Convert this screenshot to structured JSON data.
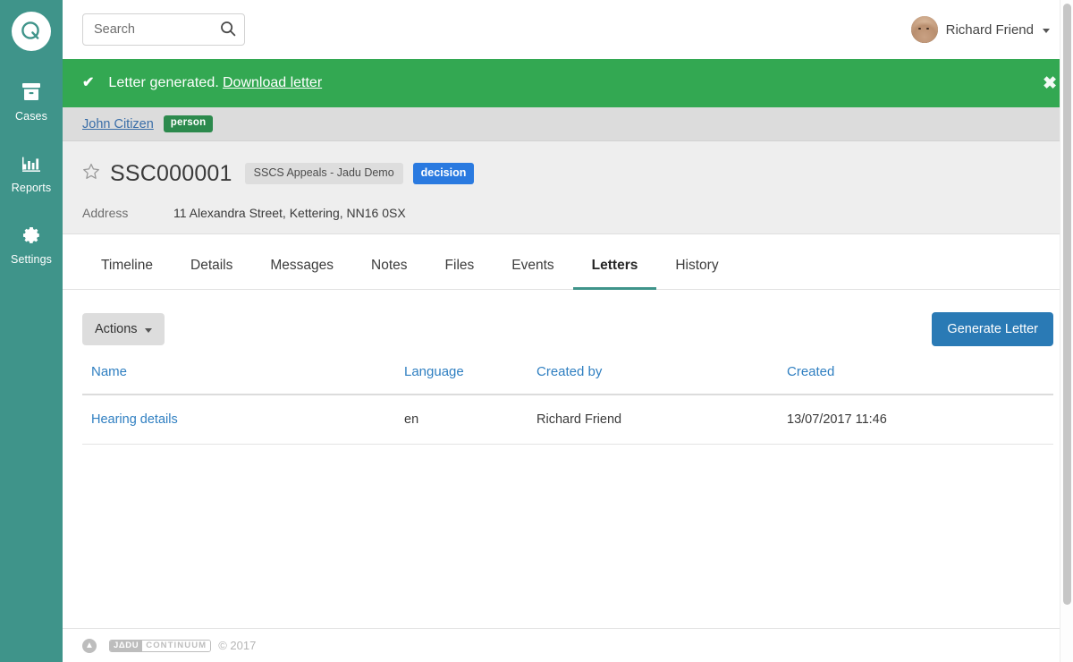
{
  "sidebar": {
    "logo_name": "jadu-q-logo",
    "items": [
      {
        "label": "Cases",
        "icon": "archive-box-icon"
      },
      {
        "label": "Reports",
        "icon": "bar-chart-icon"
      },
      {
        "label": "Settings",
        "icon": "gear-icon"
      }
    ]
  },
  "topbar": {
    "search_placeholder": "Search",
    "search_value": "",
    "user_name": "Richard Friend"
  },
  "notice": {
    "icon": "check-icon",
    "message": "Letter generated.",
    "link_label": "Download letter",
    "close_label": "✖"
  },
  "breadcrumb": {
    "person_link": "John Citizen",
    "person_badge": "person"
  },
  "case": {
    "reference": "SSC000001",
    "type_tag": "SSCS Appeals - Jadu Demo",
    "status_tag": "decision",
    "address_label": "Address",
    "address_value": "11 Alexandra Street, Kettering, NN16 0SX"
  },
  "tabs": [
    {
      "label": "Timeline",
      "active": false
    },
    {
      "label": "Details",
      "active": false
    },
    {
      "label": "Messages",
      "active": false
    },
    {
      "label": "Notes",
      "active": false
    },
    {
      "label": "Files",
      "active": false
    },
    {
      "label": "Events",
      "active": false
    },
    {
      "label": "Letters",
      "active": true
    },
    {
      "label": "History",
      "active": false
    }
  ],
  "toolbar": {
    "actions_label": "Actions",
    "generate_label": "Generate Letter"
  },
  "letters_table": {
    "columns": [
      "Name",
      "Language",
      "Created by",
      "Created"
    ],
    "rows": [
      {
        "name": "Hearing details",
        "language": "en",
        "created_by": "Richard Friend",
        "created": "13/07/2017 11:46"
      }
    ]
  },
  "footer": {
    "scroll_top_icon": "arrow-up-icon",
    "brand_part_a": "JΔDU",
    "brand_part_b": "CONTINUUM",
    "copyright": "© 2017"
  },
  "colors": {
    "sidebar": "#3f948a",
    "notice_green": "#33a852",
    "primary_blue": "#2a7ab5",
    "tag_blue": "#2a7ae0",
    "person_green": "#2c8a4d",
    "link_blue": "#2f7fc1"
  }
}
